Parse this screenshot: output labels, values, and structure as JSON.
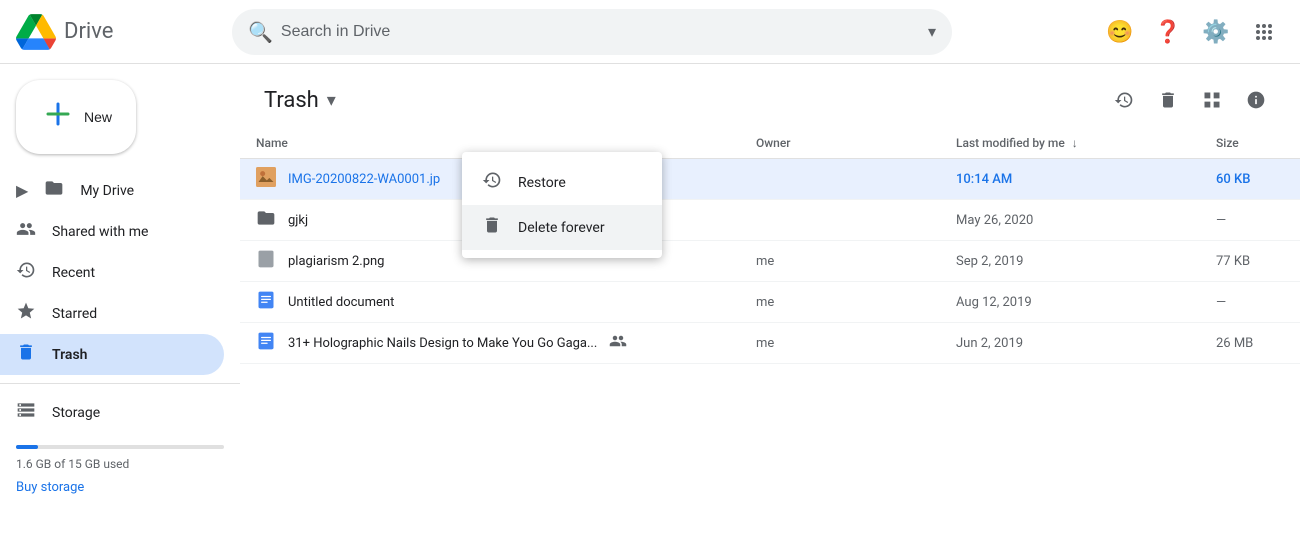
{
  "header": {
    "app_name": "Drive",
    "search_placeholder": "Search in Drive"
  },
  "sidebar": {
    "new_button_label": "New",
    "items": [
      {
        "id": "my-drive",
        "label": "My Drive",
        "icon": "📁",
        "active": false
      },
      {
        "id": "shared",
        "label": "Shared with me",
        "icon": "👥",
        "active": false
      },
      {
        "id": "recent",
        "label": "Recent",
        "icon": "🕐",
        "active": false
      },
      {
        "id": "starred",
        "label": "Starred",
        "icon": "⭐",
        "active": false
      },
      {
        "id": "trash",
        "label": "Trash",
        "icon": "🗑️",
        "active": true
      }
    ],
    "storage_label": "Storage",
    "storage_used": "1.6 GB of 15 GB used",
    "storage_percent": 10.7,
    "buy_storage_label": "Buy storage"
  },
  "content": {
    "title": "Trash",
    "toolbar": {
      "restore_title": "Restore",
      "delete_title": "Empty trash",
      "layout_title": "Switch to grid layout",
      "info_title": "View details"
    },
    "table": {
      "columns": {
        "name": "Name",
        "owner": "Owner",
        "modified": "Last modified by me",
        "size": "Size"
      },
      "rows": [
        {
          "id": 1,
          "name": "IMG-20200822-WA0001.jp",
          "icon_type": "image",
          "owner": "",
          "modified": "10:14 AM",
          "size": "60 KB",
          "selected": true,
          "shared": false
        },
        {
          "id": 2,
          "name": "gjkj",
          "icon_type": "folder",
          "owner": "",
          "modified": "May 26, 2020",
          "size": "—",
          "selected": false,
          "shared": false
        },
        {
          "id": 3,
          "name": "plagiarism 2.png",
          "icon_type": "image-gray",
          "owner": "me",
          "modified": "Sep 2, 2019",
          "size": "77 KB",
          "selected": false,
          "shared": false
        },
        {
          "id": 4,
          "name": "Untitled document",
          "icon_type": "doc",
          "owner": "me",
          "modified": "Aug 12, 2019",
          "size": "—",
          "selected": false,
          "shared": false
        },
        {
          "id": 5,
          "name": "31+ Holographic Nails Design to Make You Go Gaga...",
          "icon_type": "doc",
          "owner": "me",
          "modified": "Jun 2, 2019",
          "size": "26 MB",
          "selected": false,
          "shared": true
        }
      ]
    }
  },
  "context_menu": {
    "items": [
      {
        "id": "restore",
        "label": "Restore",
        "icon": "restore"
      },
      {
        "id": "delete-forever",
        "label": "Delete forever",
        "icon": "delete"
      }
    ]
  }
}
